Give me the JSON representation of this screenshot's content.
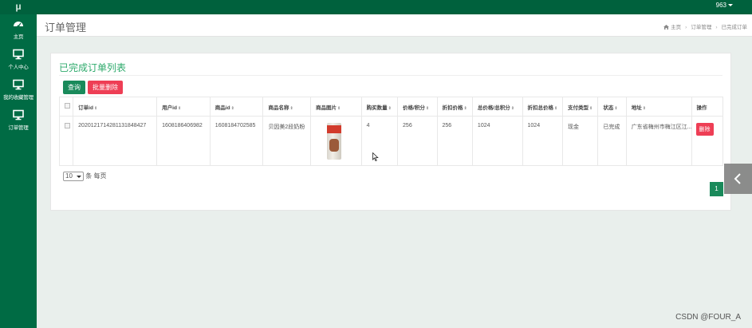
{
  "app": {
    "logo": "μ"
  },
  "topbar": {
    "user": "963"
  },
  "sidebar": {
    "items": [
      {
        "label": "主页",
        "icon": "dashboard-icon"
      },
      {
        "label": "个人中心",
        "icon": "monitor-icon"
      },
      {
        "label": "我的收藏管理",
        "icon": "monitor-icon"
      },
      {
        "label": "订单管理",
        "icon": "monitor-icon"
      }
    ]
  },
  "header": {
    "title": "订单管理",
    "breadcrumb": [
      "主页",
      "订单管理",
      "已完成订单"
    ]
  },
  "panel": {
    "title": "已完成订单列表",
    "query_label": "查询",
    "batch_delete_label": "批量删除"
  },
  "table": {
    "columns": [
      "订单id",
      "用户id",
      "商品id",
      "商品名称",
      "商品图片",
      "购买数量",
      "价格/积分",
      "折扣价格",
      "总价格/总积分",
      "折扣总价格",
      "支付类型",
      "状态",
      "地址",
      "操作"
    ],
    "rows": [
      {
        "order_id": "2020121714281131848427",
        "user_id": "1608186406982",
        "product_id": "1608184702585",
        "product_name": "贝因美2段奶粉",
        "quantity": "4",
        "price": "256",
        "discount_price": "256",
        "total": "1024",
        "discount_total": "1024",
        "pay_type": "现金",
        "status": "已完成",
        "address": "广东省梅州市梅江区江...",
        "action": "删除"
      }
    ]
  },
  "pagination": {
    "page_size": "10",
    "page_size_suffix": "条 每页",
    "current_page": "1"
  },
  "watermark": "CSDN @FOUR_A",
  "colors": {
    "brand": "#006b44",
    "accent": "#1a8a5b",
    "danger": "#ee3e55"
  }
}
